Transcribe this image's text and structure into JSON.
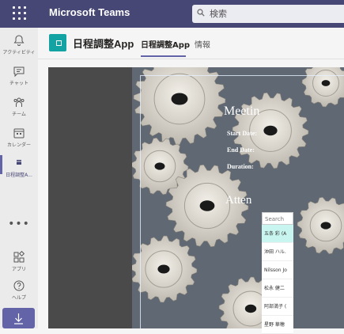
{
  "topbar": {
    "app_name": "Microsoft Teams",
    "search_placeholder": "検索"
  },
  "rail": {
    "items": [
      {
        "label": "アクティビティ"
      },
      {
        "label": "チャット"
      },
      {
        "label": "チーム"
      },
      {
        "label": "カレンダー"
      },
      {
        "label": "日程調整A..."
      }
    ],
    "bottom": [
      {
        "label": "アプリ"
      },
      {
        "label": "ヘルプ"
      }
    ],
    "more": "•••"
  },
  "header": {
    "app_name": "日程調整App",
    "tabs": [
      {
        "label": "日程調整App"
      },
      {
        "label": "情報"
      }
    ]
  },
  "main": {
    "meeting_title": "Meetin",
    "fields": {
      "start_date": "Start Date:",
      "end_date": "End Date:",
      "duration": "Duration:"
    },
    "attendees_title": "Atten",
    "search_placeholder": "Search use",
    "people": [
      {
        "name": "五条 彩 (A"
      },
      {
        "name": "沖田 ハル."
      },
      {
        "name": "Nilsson Jo"
      },
      {
        "name": "松永 健二"
      },
      {
        "name": "阿部満子 ("
      },
      {
        "name": "星野 華穂"
      }
    ]
  },
  "colors": {
    "topbar": "#464775",
    "accent": "#6264a7",
    "app_icon": "#13a3a3",
    "selected_row": "#c8f5ef"
  }
}
